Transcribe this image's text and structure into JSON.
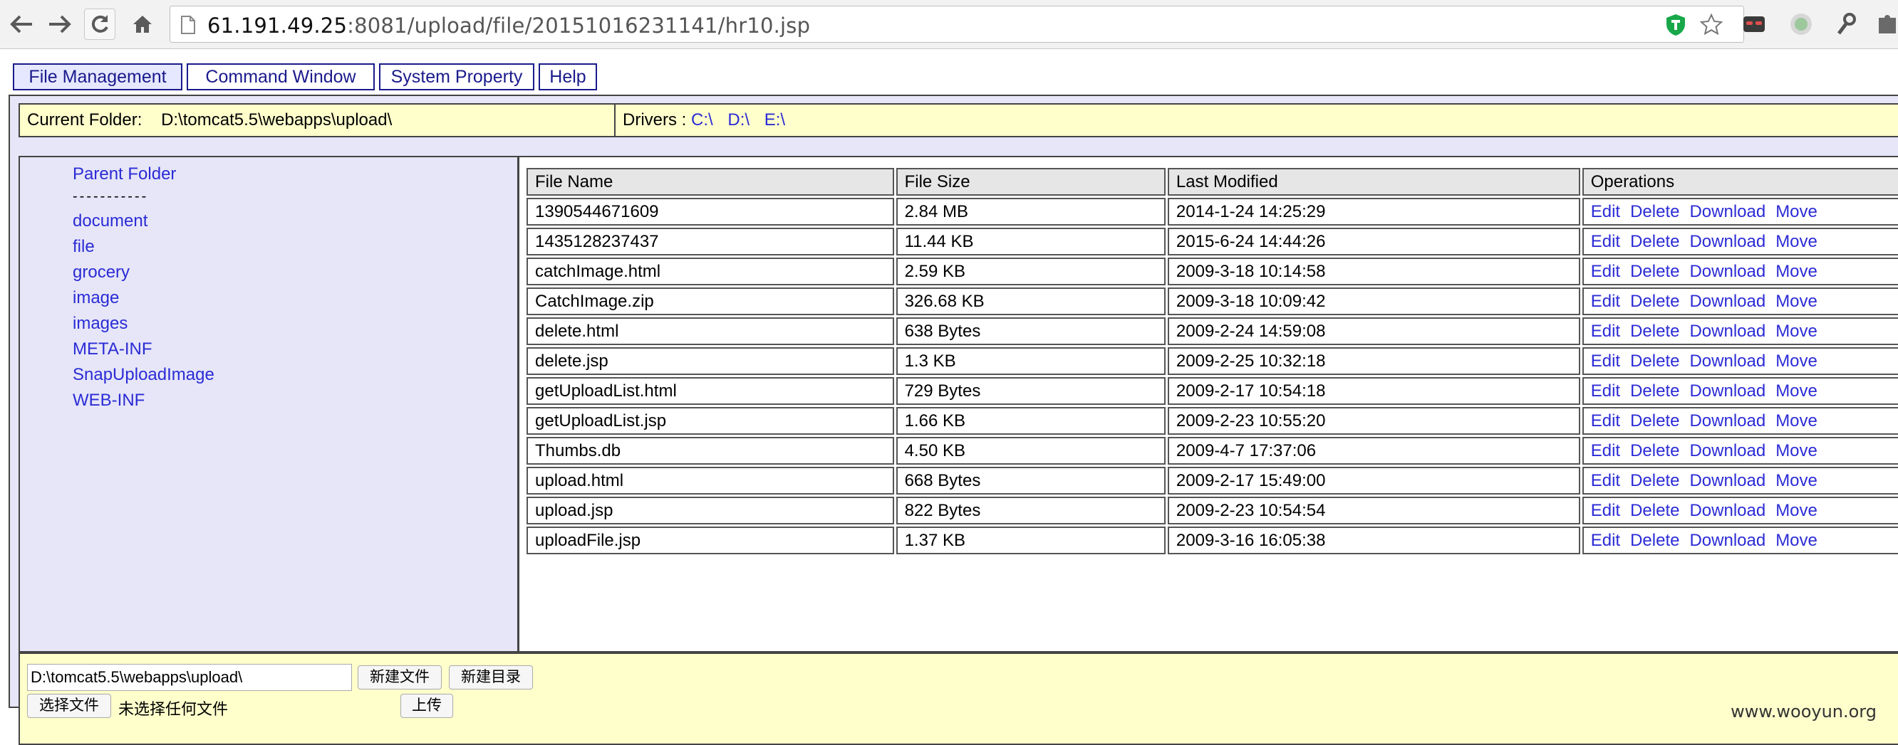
{
  "browser": {
    "url_host": "61.191.49.25",
    "url_rest": ":8081/upload/file/20151016231141/hr10.jsp"
  },
  "menu": {
    "items": [
      {
        "label": "File Management",
        "active": true
      },
      {
        "label": "Command Window"
      },
      {
        "label": "System Property"
      },
      {
        "label": "Help"
      }
    ]
  },
  "folder_bar": {
    "current_label": "Current Folder:",
    "current_path": "D:\\tomcat5.5\\webapps\\upload\\",
    "drivers_label": "Drivers :",
    "drivers": [
      "C:\\",
      "D:\\",
      "E:\\"
    ]
  },
  "sidebar": {
    "parent_label": "Parent Folder",
    "dashes": "-----------",
    "folders": [
      "document",
      "file",
      "grocery",
      "image",
      "images",
      "META-INF",
      "SnapUploadImage",
      "WEB-INF"
    ]
  },
  "table": {
    "headers": [
      "File Name",
      "File Size",
      "Last Modified",
      "Operations"
    ],
    "operations": [
      "Edit",
      "Delete",
      "Download",
      "Move"
    ],
    "rows": [
      {
        "name": "1390544671609",
        "size": "2.84 MB",
        "modified": "2014-1-24 14:25:29"
      },
      {
        "name": "1435128237437",
        "size": "11.44 KB",
        "modified": "2015-6-24 14:44:26"
      },
      {
        "name": "catchImage.html",
        "size": "2.59 KB",
        "modified": "2009-3-18 10:14:58"
      },
      {
        "name": "CatchImage.zip",
        "size": "326.68 KB",
        "modified": "2009-3-18 10:09:42"
      },
      {
        "name": "delete.html",
        "size": "638 Bytes",
        "modified": "2009-2-24 14:59:08"
      },
      {
        "name": "delete.jsp",
        "size": "1.3 KB",
        "modified": "2009-2-25 10:32:18"
      },
      {
        "name": "getUploadList.html",
        "size": "729 Bytes",
        "modified": "2009-2-17 10:54:18"
      },
      {
        "name": "getUploadList.jsp",
        "size": "1.66 KB",
        "modified": "2009-2-23 10:55:20"
      },
      {
        "name": "Thumbs.db",
        "size": "4.50 KB",
        "modified": "2009-4-7 17:37:06"
      },
      {
        "name": "upload.html",
        "size": "668 Bytes",
        "modified": "2009-2-17 15:49:00"
      },
      {
        "name": "upload.jsp",
        "size": "822 Bytes",
        "modified": "2009-2-23 10:54:54"
      },
      {
        "name": "uploadFile.jsp",
        "size": "1.37 KB",
        "modified": "2009-3-16 16:05:38"
      }
    ]
  },
  "upload": {
    "path_value": "D:\\tomcat5.5\\webapps\\upload\\",
    "new_file_label": "新建文件",
    "new_dir_label": "新建目录",
    "choose_file_label": "选择文件",
    "no_file_text": "未选择任何文件",
    "upload_label": "上传"
  },
  "watermark": "www.wooyun.org"
}
